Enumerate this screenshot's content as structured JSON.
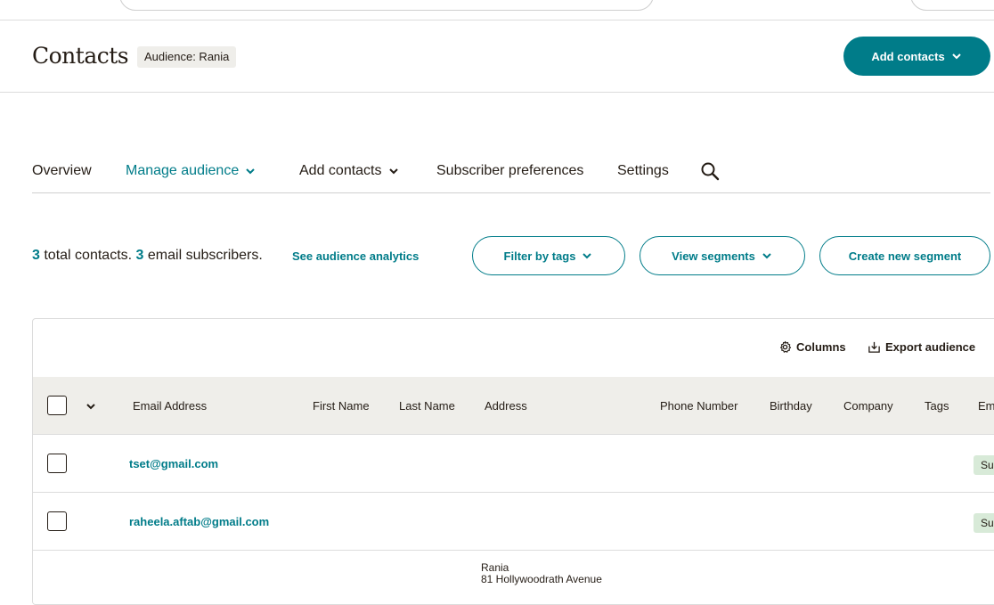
{
  "header": {
    "title": "Contacts",
    "audience_badge": "Audience: Rania",
    "add_contacts_label": "Add contacts"
  },
  "tabs": [
    {
      "label": "Overview",
      "active": false
    },
    {
      "label": "Manage audience",
      "active": true
    },
    {
      "label": "Add contacts",
      "active": false
    },
    {
      "label": "Subscriber preferences",
      "active": false
    },
    {
      "label": "Settings",
      "active": false
    }
  ],
  "summary": {
    "total_count": "3",
    "total_text": "total contacts.",
    "email_count": "3",
    "email_text": "email subscribers.",
    "analytics_link": "See audience analytics"
  },
  "actions": {
    "filter_tags": "Filter by tags",
    "view_segments": "View segments",
    "create_segment": "Create new segment"
  },
  "table": {
    "toolbar": {
      "columns": "Columns",
      "export": "Export audience"
    },
    "columns": [
      "Email Address",
      "First Name",
      "Last Name",
      "Address",
      "Phone Number",
      "Birthday",
      "Company",
      "Tags",
      "Em"
    ],
    "rows": [
      {
        "email": "tset@gmail.com",
        "status": "Su"
      },
      {
        "email": "raheela.aftab@gmail.com",
        "status": "Su"
      },
      {
        "email": "",
        "address_line1": "Rania",
        "address_line2": "81 Hollywoodrath Avenue"
      }
    ]
  },
  "colors": {
    "accent": "#007c89",
    "header_bg": "#efeeea",
    "status_bg": "#d8ead8"
  }
}
